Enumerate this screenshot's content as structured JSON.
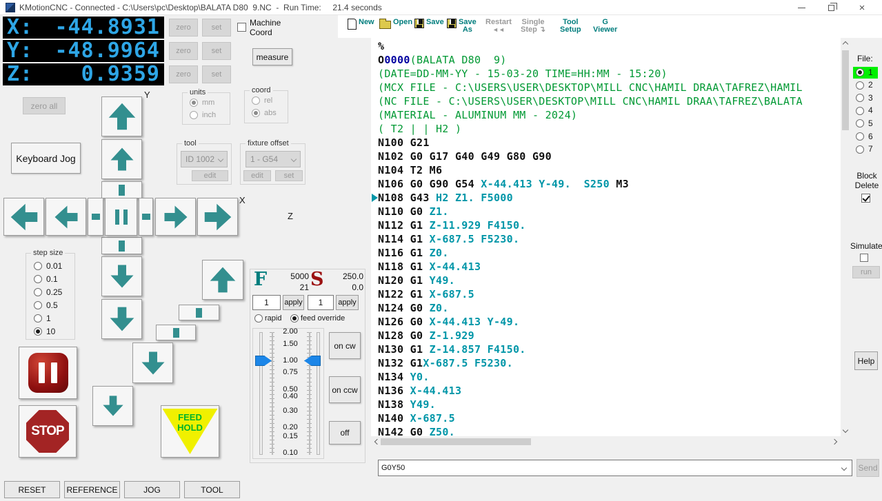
{
  "title_bar": {
    "title": "KMotionCNC - Connected - C:\\Users\\pc\\Desktop\\BALATA D80  9.NC  -  Run Time:     21.4 seconds"
  },
  "toolbar": {
    "items": [
      {
        "label_lines": [
          "New"
        ],
        "icon": "page-icon",
        "enabled": true
      },
      {
        "label_lines": [
          "Open"
        ],
        "icon": "open-folder-icon",
        "enabled": true
      },
      {
        "label_lines": [
          "Save"
        ],
        "icon": "floppy-icon",
        "enabled": true
      },
      {
        "label_lines": [
          "Save",
          "As"
        ],
        "icon": "floppy-icon",
        "enabled": true
      },
      {
        "label_lines": [
          "Restart"
        ],
        "icon": "",
        "enabled": false,
        "sub": "◄◄"
      },
      {
        "label_lines": [
          "Single",
          "Step ↴"
        ],
        "icon": "",
        "enabled": false
      },
      {
        "label_lines": [
          "Tool",
          "Setup"
        ],
        "icon": "",
        "enabled": true
      },
      {
        "label_lines": [
          "G",
          "Viewer"
        ],
        "icon": "",
        "enabled": true
      }
    ]
  },
  "dro": {
    "axes": [
      {
        "label": "X:",
        "value": "-44.8931"
      },
      {
        "label": "Y:",
        "value": "-48.9964"
      },
      {
        "label": "Z:",
        "value": "0.9359"
      }
    ],
    "zero_label": "zero",
    "set_label": "set",
    "zero_all_label": "zero all",
    "keyboard_jog_label": "Keyboard Jog",
    "machine_coord_line1": "Machine",
    "machine_coord_line2": "Coord",
    "machine_coord_checked": false,
    "measure_label": "measure"
  },
  "jog": {
    "x_label": "X",
    "y_label": "Y",
    "z_label": "Z"
  },
  "groups": {
    "units": {
      "title": "units",
      "options": [
        "mm",
        "inch"
      ],
      "selected": "mm"
    },
    "coord": {
      "title": "coord",
      "options": [
        "rel",
        "abs"
      ],
      "selected": "abs"
    },
    "tool": {
      "title": "tool",
      "value": "ID 1002",
      "edit_label": "edit"
    },
    "fixture": {
      "title": "fixture offset",
      "value": "1 - G54",
      "edit_label": "edit",
      "set_label": "set"
    },
    "step_size": {
      "title": "step size",
      "options": [
        "0.01",
        "0.1",
        "0.25",
        "0.5",
        "1",
        "10"
      ],
      "selected": "10"
    }
  },
  "feed_speed": {
    "f_label": "F",
    "f_commanded": "5000",
    "f_actual": "21",
    "s_label": "S",
    "s_commanded": "250.0",
    "s_actual": "0.0",
    "feed_input": "1",
    "speed_input": "1",
    "apply_label": "apply",
    "mode_options": [
      "rapid",
      "feed override"
    ],
    "mode_selected": "feed override",
    "scale_ticks": [
      "2.00",
      "1.50",
      "1.00",
      "0.75",
      "0.50",
      "0.40",
      "0.30",
      "0.20",
      "0.15",
      "0.10"
    ],
    "override_value": "1.00",
    "on_cw_label": "on cw",
    "on_ccw_label": "on ccw",
    "off_label": "off"
  },
  "big_buttons": {
    "stop_label": "STOP",
    "feed_hold_line1": "FEED",
    "feed_hold_line2": "HOLD"
  },
  "bottom_buttons": [
    "RESET",
    "REFERENCE",
    "JOG",
    "TOOL"
  ],
  "right_panel": {
    "file_label": "File:",
    "files": [
      "1",
      "2",
      "3",
      "4",
      "5",
      "6",
      "7"
    ],
    "selected_file": "1",
    "block_delete_line1": "Block",
    "block_delete_line2": "Delete",
    "block_delete_checked": true,
    "simulate_label": "Simulate",
    "simulate_checked": false,
    "run_label": "run",
    "help_label": "Help"
  },
  "command": {
    "value": "G0Y50",
    "send_label": "Send"
  },
  "gcode": {
    "current_line_index": 11,
    "lines": [
      [
        [
          "k",
          "%"
        ]
      ],
      [
        [
          "k",
          "O"
        ],
        [
          "b",
          "0000"
        ],
        [
          "g",
          "(BALATA D80  9)"
        ]
      ],
      [
        [
          "g",
          "(DATE=DD-MM-YY - 15-03-20 TIME=HH:MM - 15:20)"
        ]
      ],
      [
        [
          "g",
          "(MCX FILE - C:\\USERS\\USER\\DESKTOP\\MILL CNC\\HAMIL DRAA\\TAFREZ\\HAMIL"
        ]
      ],
      [
        [
          "g",
          "(NC FILE - C:\\USERS\\USER\\DESKTOP\\MILL CNC\\HAMIL DRAA\\TAFREZ\\BALATA"
        ]
      ],
      [
        [
          "g",
          "(MATERIAL - ALUMINUM MM - 2024)"
        ]
      ],
      [
        [
          "g",
          "( T2 | | H2 )"
        ]
      ],
      [
        [
          "k",
          "N100 G21"
        ]
      ],
      [
        [
          "k",
          "N102 G0 G17 G40 G49 G80 G90"
        ]
      ],
      [
        [
          "k",
          "N104 T2 M6"
        ]
      ],
      [
        [
          "k",
          "N106 G0 G90 G54 "
        ],
        [
          "t",
          "X-44.413 Y-49.  S250"
        ],
        [
          "k",
          " M3"
        ]
      ],
      [
        [
          "k",
          "N108 G43 "
        ],
        [
          "t",
          "H2 Z1. F5000"
        ]
      ],
      [
        [
          "k",
          "N110 G0 "
        ],
        [
          "t",
          "Z1."
        ]
      ],
      [
        [
          "k",
          "N112 G1 "
        ],
        [
          "t",
          "Z-11.929 F4150."
        ]
      ],
      [
        [
          "k",
          "N114 G1 "
        ],
        [
          "t",
          "X-687.5 F5230."
        ]
      ],
      [
        [
          "k",
          "N116 G1 "
        ],
        [
          "t",
          "Z0."
        ]
      ],
      [
        [
          "k",
          "N118 G1 "
        ],
        [
          "t",
          "X-44.413"
        ]
      ],
      [
        [
          "k",
          "N120 G1 "
        ],
        [
          "t",
          "Y49."
        ]
      ],
      [
        [
          "k",
          "N122 G1 "
        ],
        [
          "t",
          "X-687.5"
        ]
      ],
      [
        [
          "k",
          "N124 G0 "
        ],
        [
          "t",
          "Z0."
        ]
      ],
      [
        [
          "k",
          "N126 G0 "
        ],
        [
          "t",
          "X-44.413 Y-49."
        ]
      ],
      [
        [
          "k",
          "N128 G0 "
        ],
        [
          "t",
          "Z-1.929"
        ]
      ],
      [
        [
          "k",
          "N130 G1 "
        ],
        [
          "t",
          "Z-14.857 F4150."
        ]
      ],
      [
        [
          "k",
          "N132 G1"
        ],
        [
          "t",
          "X-687.5 F5230."
        ]
      ],
      [
        [
          "k",
          "N134 "
        ],
        [
          "t",
          "Y0."
        ]
      ],
      [
        [
          "k",
          "N136 "
        ],
        [
          "t",
          "X-44.413"
        ]
      ],
      [
        [
          "k",
          "N138 "
        ],
        [
          "t",
          "Y49."
        ]
      ],
      [
        [
          "k",
          "N140 "
        ],
        [
          "t",
          "X-687.5"
        ]
      ],
      [
        [
          "k",
          "N142 G0 "
        ],
        [
          "t",
          "Z50."
        ]
      ]
    ]
  },
  "colors": {
    "accent_teal": "#007d7d",
    "dro_blue": "#2ea6e6",
    "code_teal": "#0096a8",
    "comment_green": "#009933",
    "onum_navy": "#0000a0",
    "stop_red": "#a32424",
    "pause_red": "#8f1010",
    "feed_hold_yellow": "#f0f000",
    "feed_hold_green": "#00b42a",
    "file_selected_green": "#00f000",
    "slider_blue": "#1c86e8",
    "arrow_teal": "#338f8f"
  }
}
